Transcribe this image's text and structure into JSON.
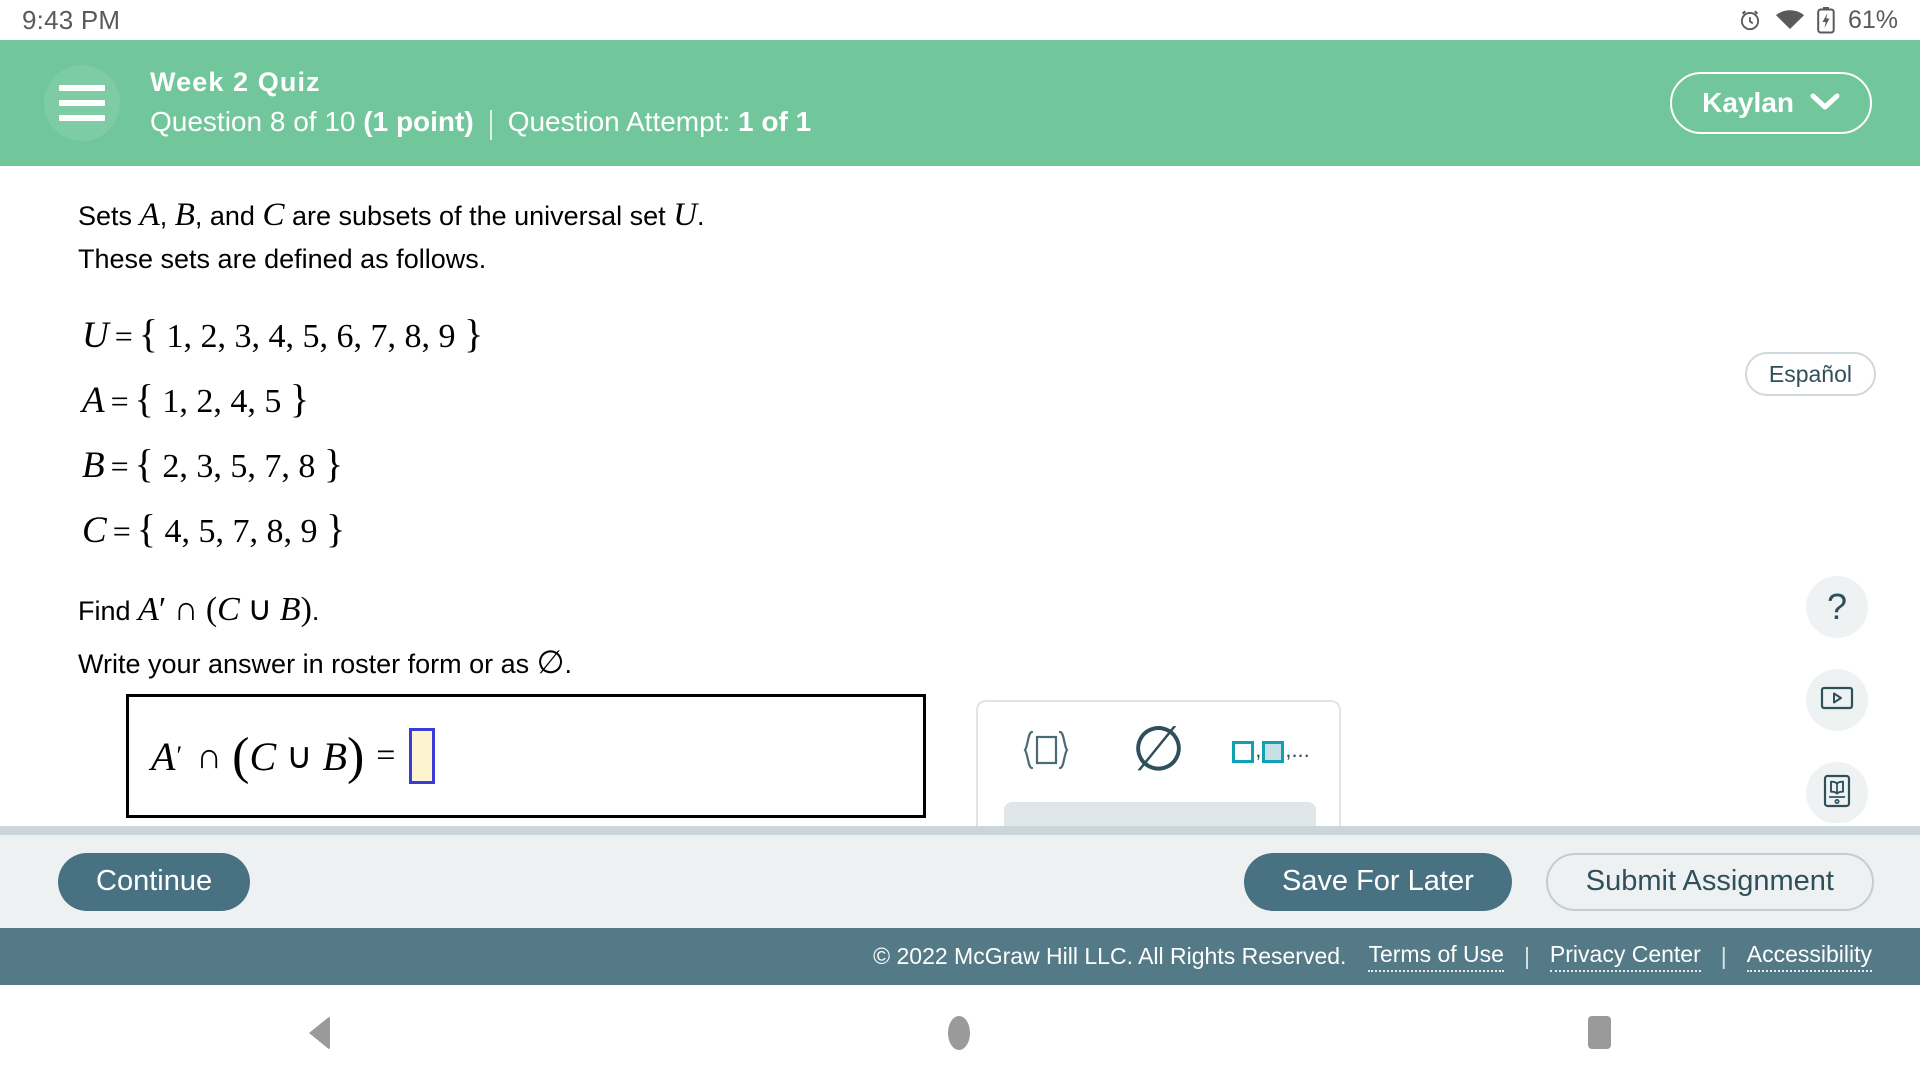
{
  "statusbar": {
    "time": "9:43 PM",
    "battery": "61%",
    "icons": [
      "alarm-icon",
      "wifi-icon",
      "battery-charging-icon"
    ]
  },
  "header": {
    "menu_icon": "hamburger-menu-icon",
    "title": "Week 2 Quiz",
    "question_label": "Question 8 of 10",
    "points": "(1 point)",
    "attempt_label": "Question Attempt:",
    "attempt_value": "1 of 1",
    "user_name": "Kaylan",
    "user_caret": "chevron-down-icon",
    "bg_color": "#71c79b"
  },
  "question": {
    "intro_prefix": "Sets ",
    "intro_a": "A",
    "intro_comma1": ", ",
    "intro_b": "B",
    "intro_and": ", and ",
    "intro_c": "C",
    "intro_mid": " are subsets of the universal set ",
    "intro_u": "U",
    "intro_end": ".",
    "line2": "These sets are defined as follows.",
    "sets": [
      {
        "name": "U",
        "elements": "1, 2, 3, 4, 5, 6, 7, 8, 9"
      },
      {
        "name": "A",
        "elements": "1, 2, 4, 5"
      },
      {
        "name": "B",
        "elements": "2, 3, 5, 7, 8"
      },
      {
        "name": "C",
        "elements": "4, 5, 7, 8, 9"
      }
    ],
    "find_prefix": "Find ",
    "find_expr_a": "A",
    "find_prime": "′",
    "find_intersect": "∩",
    "find_open": "(",
    "find_c": "C",
    "find_union": "∪",
    "find_b": "B",
    "find_close": ")",
    "find_period": ".",
    "roster_text_a": "Write your answer in roster form or as ",
    "roster_symbol": "∅",
    "roster_text_b": "."
  },
  "answer": {
    "expr_a": "A",
    "expr_prime": "′",
    "expr_intersect": "∩",
    "expr_open": "(",
    "expr_c": "C",
    "expr_union": "∪",
    "expr_b": "B",
    "expr_close": ")",
    "expr_equals": "=",
    "input_value": "",
    "input_bg": "#fdf3cf",
    "input_border": "#3b3bd6"
  },
  "palette": {
    "buttons": [
      {
        "name": "set-braces-button",
        "icon": "set-braces-icon",
        "label": "{□}"
      },
      {
        "name": "empty-set-button",
        "icon": "empty-set-icon",
        "label": "∅"
      },
      {
        "name": "comma-list-button",
        "icon": "comma-list-icon",
        "label": "□,□,..."
      }
    ],
    "list_suffix": ",...",
    "list_comma": ",",
    "accent_color": "#12a0b5"
  },
  "tools": {
    "espanol_label": "Español",
    "help_label": "?",
    "video_icon": "video-play-icon",
    "ebook_icon": "ebook-icon"
  },
  "actions": {
    "continue_label": "Continue",
    "save_label": "Save For Later",
    "submit_label": "Submit Assignment",
    "primary_color": "#487281"
  },
  "footer": {
    "copyright": "© 2022 McGraw Hill LLC. All Rights Reserved.",
    "links": [
      "Terms of Use",
      "Privacy Center",
      "Accessibility"
    ],
    "separator": "|",
    "bg_color": "#537a86"
  },
  "navbar": {
    "back": "back-triangle-icon",
    "home": "home-circle-icon",
    "recent": "recent-square-icon"
  }
}
